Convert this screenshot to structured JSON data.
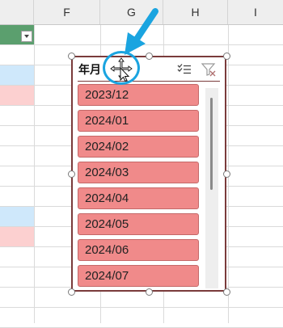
{
  "columns": {
    "F": "F",
    "G": "G",
    "H": "H",
    "I": "I"
  },
  "slicer": {
    "title": "年月",
    "items": [
      "2023/12",
      "2024/01",
      "2024/02",
      "2024/03",
      "2024/04",
      "2024/05",
      "2024/06",
      "2024/07"
    ],
    "item_color": "#f08a8a",
    "border_color": "#7a3b3b"
  },
  "annotation": {
    "color": "#1aa4e0"
  },
  "icons": {
    "move_cursor": "move-cursor-icon",
    "multiselect": "multi-select-icon",
    "clear_filter": "clear-filter-icon"
  }
}
